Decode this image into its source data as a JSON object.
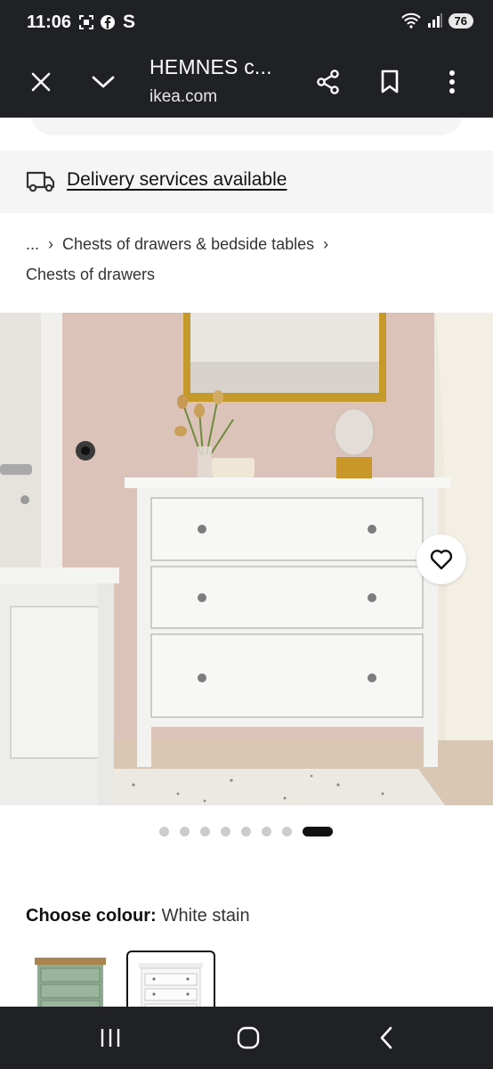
{
  "status_bar": {
    "time": "11:06",
    "letter": "S",
    "battery": "76"
  },
  "toolbar": {
    "title": "HEMNES c...",
    "url": "ikea.com",
    "icons": [
      "close-icon",
      "chevron-down-icon",
      "share-icon",
      "bookmark-icon",
      "more-icon"
    ]
  },
  "delivery": {
    "text": "Delivery services available"
  },
  "breadcrumb": {
    "ellipsis": "...",
    "category": "Chests of drawers & bedside tables",
    "current": "Chests of drawers"
  },
  "gallery": {
    "image_count": 8,
    "active_index": 7
  },
  "colour": {
    "label": "Choose colour:",
    "value": "White stain"
  },
  "colours": {
    "accent": "#111111",
    "dark_chrome": "#202124",
    "light_panel": "#f5f5f5"
  }
}
